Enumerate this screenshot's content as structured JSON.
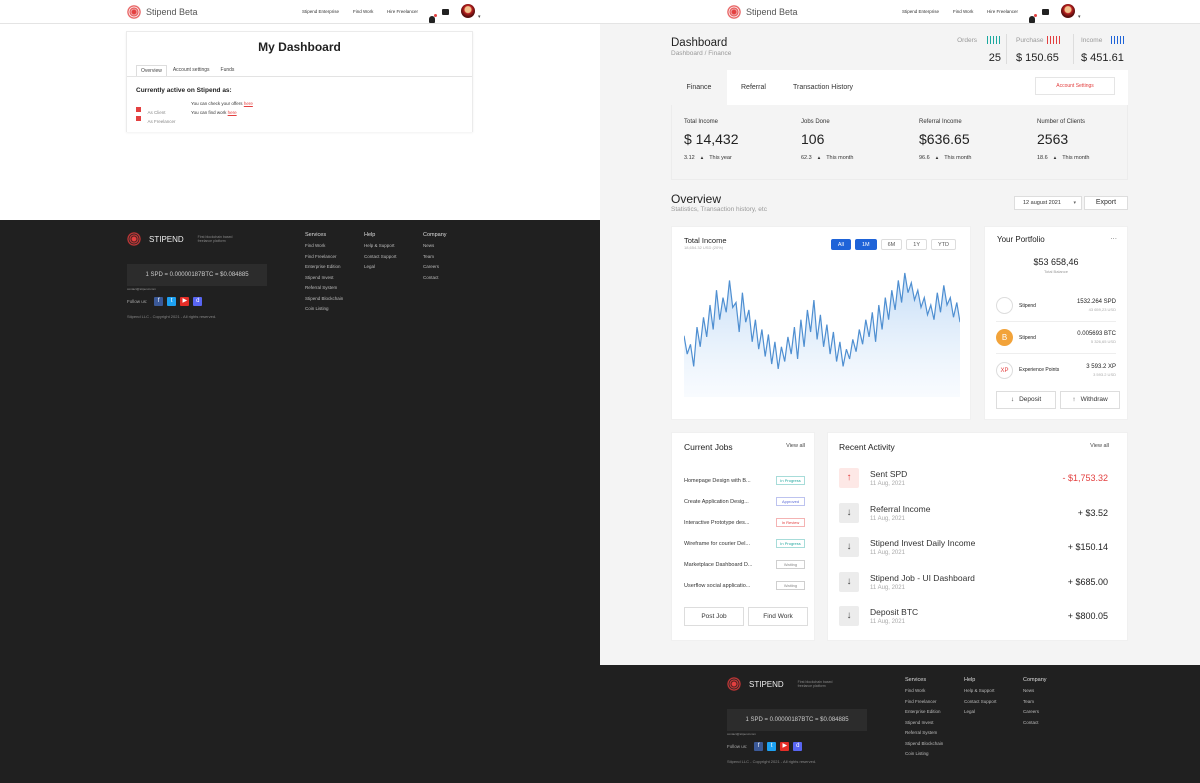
{
  "app": {
    "brand": "Stipend Beta",
    "nav_links": [
      "Stipend Enterprise",
      "Find Work",
      "Hire Freelancer"
    ]
  },
  "left_panel": {
    "title": "My Dashboard",
    "tabs": [
      "Overview",
      "Account settings",
      "Funds"
    ],
    "active_tab": "Overview",
    "active_heading": "Currently active on Stipend as:",
    "roles": [
      {
        "label": "As Client",
        "text": "You can check your offers",
        "link": "here"
      },
      {
        "label": "As Freelancer",
        "text": "You can find work",
        "link": "here"
      }
    ]
  },
  "footer": {
    "brand": "STIPEND",
    "tagline_1": "First blockchain based",
    "tagline_2": "freelance platform",
    "rate": "1 SPD = 0.00000187BTC = $0.084885",
    "email": "contact@stipend.com",
    "follow": "Follow us:",
    "copyright": "Stipend LLC - Copyright 2021 - All rights reserved.",
    "columns": [
      {
        "title": "Services",
        "items": [
          "Find Work",
          "Find Freelancer",
          "Enterprise Edition",
          "Stipend Invest",
          "Referral System",
          "Stipend Blockchain",
          "Coin Listing"
        ]
      },
      {
        "title": "Help",
        "items": [
          "Help & Support",
          "Contact Support",
          "Legal"
        ]
      },
      {
        "title": "Company",
        "items": [
          "News",
          "Team",
          "Careers",
          "Contact"
        ]
      }
    ],
    "social": [
      {
        "icon": "facebook-icon",
        "glyph": "f",
        "color": "#3b5998"
      },
      {
        "icon": "twitter-icon",
        "glyph": "t",
        "color": "#1da1f2"
      },
      {
        "icon": "youtube-icon",
        "glyph": "▶",
        "color": "#e52d27"
      },
      {
        "icon": "discord-icon",
        "glyph": "d",
        "color": "#5865f2"
      }
    ]
  },
  "dashboard": {
    "title": "Dashboard",
    "breadcrumb": "Dashboard / Finance",
    "summary": [
      {
        "label": "Orders",
        "value": "25"
      },
      {
        "label": "Purchase",
        "value": "$ 150.65"
      },
      {
        "label": "Income",
        "value": "$ 451.61"
      }
    ],
    "tabs": [
      "Finance",
      "Referral",
      "Transaction History"
    ],
    "active_tab": "Finance",
    "account_settings": "Account Settings",
    "stats": [
      {
        "label": "Total Income",
        "value": "$ 14,432",
        "delta": "3.12",
        "period": "This year"
      },
      {
        "label": "Jobs Done",
        "value": "106",
        "delta": "62.3",
        "period": "This month"
      },
      {
        "label": "Referral Income",
        "value": "$636.65",
        "delta": "96.6",
        "period": "This month"
      },
      {
        "label": "Number of Clients",
        "value": "2563",
        "delta": "18.6",
        "period": "This month"
      }
    ],
    "overview_title": "Overview",
    "overview_subtitle": "Statistics, Transaction history, etc",
    "date": "12 august 2021",
    "export": "Export"
  },
  "income_card": {
    "title": "Total Income",
    "subtitle": "18,654.32 USD (20%)",
    "ranges": [
      "All",
      "1M",
      "6M",
      "1Y",
      "YTD"
    ],
    "active_ranges": [
      "All",
      "1M"
    ]
  },
  "chart_data": {
    "type": "area",
    "title": "Total Income",
    "subtitle": "18,654.32 USD (20%)",
    "xlabel": "",
    "ylabel": "",
    "values": [
      45,
      30,
      38,
      20,
      52,
      36,
      60,
      44,
      70,
      50,
      82,
      58,
      76,
      64,
      90,
      68,
      72,
      48,
      80,
      56,
      66,
      40,
      58,
      34,
      50,
      28,
      46,
      22,
      40,
      18,
      36,
      24,
      44,
      30,
      52,
      26,
      58,
      36,
      66,
      48,
      74,
      42,
      62,
      36,
      54,
      30,
      48,
      24,
      40,
      20,
      34,
      26,
      42,
      32,
      50,
      38,
      58,
      44,
      64,
      40,
      70,
      50,
      76,
      58,
      82,
      66,
      90,
      72,
      96,
      80,
      88,
      74,
      82,
      68,
      76,
      62,
      70,
      58,
      80,
      64,
      86,
      70,
      76,
      60,
      72,
      56
    ]
  },
  "portfolio": {
    "title": "Your Portfolio",
    "more": "...",
    "total": "$53 658,46",
    "total_label": "Total Balance",
    "coins": [
      {
        "name": "Stipend",
        "amount": "1532.264 SPD",
        "usd": "43 659,23 USD",
        "icon": "stipend-coin-icon",
        "color": "#ffffff",
        "glyph": ""
      },
      {
        "name": "Stipend",
        "amount": "0.005693 BTC",
        "usd": "5 326,65 USD",
        "icon": "bitcoin-icon",
        "color": "#f2a33a",
        "glyph": "B"
      },
      {
        "name": "Experience Points",
        "amount": "3 593.2 XP",
        "usd": "3 593.2 USD",
        "icon": "xp-icon",
        "color": "#ffffff",
        "glyph": "XP"
      }
    ],
    "deposit": "Deposit",
    "withdraw": "Withdraw"
  },
  "jobs": {
    "title": "Current Jobs",
    "view_all": "View all",
    "items": [
      {
        "name": "Homepage Design with B...",
        "status": "In Progress",
        "color": "#22a8a0"
      },
      {
        "name": "Create Application Desig...",
        "status": "Approved",
        "color": "#5a6ad8"
      },
      {
        "name": "Interactive Prototype des...",
        "status": "In Review",
        "color": "#e34040"
      },
      {
        "name": "Wireframe for courier Del...",
        "status": "In Progress",
        "color": "#22a8a0"
      },
      {
        "name": "Marketplace Dashboard D...",
        "status": "Waiting",
        "color": "#888888"
      },
      {
        "name": "Userflow social applicatio...",
        "status": "Waiting",
        "color": "#888888"
      }
    ],
    "post_job": "Post Job",
    "find_work": "Find Work"
  },
  "activity": {
    "title": "Recent Activity",
    "view_all": "View all",
    "items": [
      {
        "title": "Sent SPD",
        "date": "11 Aug, 2021",
        "amount": "- $1,753.32",
        "dir": "up"
      },
      {
        "title": "Referral Income",
        "date": "11 Aug, 2021",
        "amount": "+ $3.52",
        "dir": "down"
      },
      {
        "title": "Stipend Invest Daily Income",
        "date": "11 Aug, 2021",
        "amount": "+ $150.14",
        "dir": "down"
      },
      {
        "title": "Stipend Job - UI Dashboard",
        "date": "11 Aug, 2021",
        "amount": "+ $685.00",
        "dir": "down"
      },
      {
        "title": "Deposit BTC",
        "date": "11 Aug, 2021",
        "amount": "+ $800.05",
        "dir": "down"
      }
    ]
  }
}
